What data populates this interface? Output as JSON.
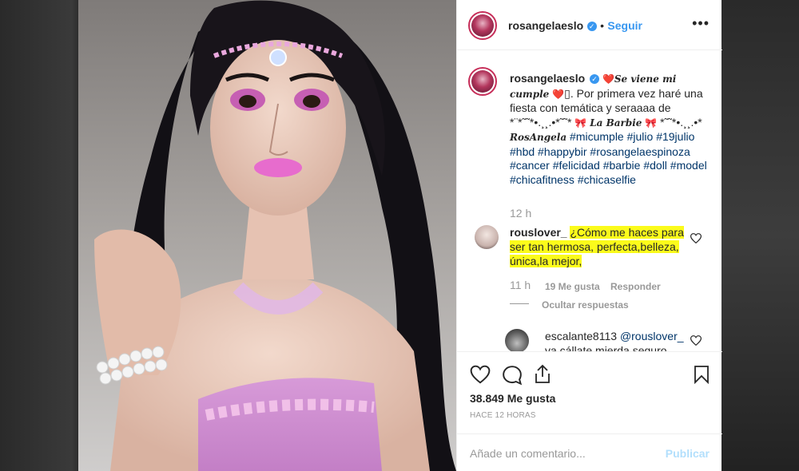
{
  "post": {
    "username": "rosangelaeslo",
    "follow_label": "Seguir",
    "separator": "•",
    "more_label": "•••",
    "caption": {
      "heart1": "❤️",
      "fancy1": "Se viene mi cumple",
      "heart2": "❤️",
      "box": "▯",
      "text1": ". Por primera vez haré una fiesta con temática y seraaaa de *¨*˜˜*•.¸¸.•*˜˜*",
      "bow1": "🎀",
      "fancy2": "La Barbie",
      "bow2": "🎀",
      "text2": "*˜˜*•.¸¸.•*",
      "fancy3": "RosAngela",
      "hashtags": "#micumple #julio #19julio #hbd #happybir #rosangelaespinoza #cancer #felicidad #barbie #doll #model #chicafitness #chicaselfie"
    },
    "caption_time": "12 h",
    "comment": {
      "username": "rouslover_",
      "text": "¿Cómo me haces para ser tan hermosa, perfecta,belleza, única,la mejor,",
      "time": "11 h",
      "likes": "19 Me gusta",
      "reply": "Responder",
      "hide_replies": "Ocultar respuestas"
    },
    "reply": {
      "username": "escalante8113",
      "mention": "@rouslover_",
      "text": "va cállate mierda seguro"
    },
    "likes_count": "38.849 Me gusta",
    "posted_ago": "HACE 12 HORAS",
    "comment_placeholder": "Añade un comentario...",
    "publish_label": "Publicar"
  },
  "colors": {
    "accent": "#3897f0",
    "highlight": "#fbfb1b",
    "hashtag": "#003569",
    "muted": "#999999"
  }
}
